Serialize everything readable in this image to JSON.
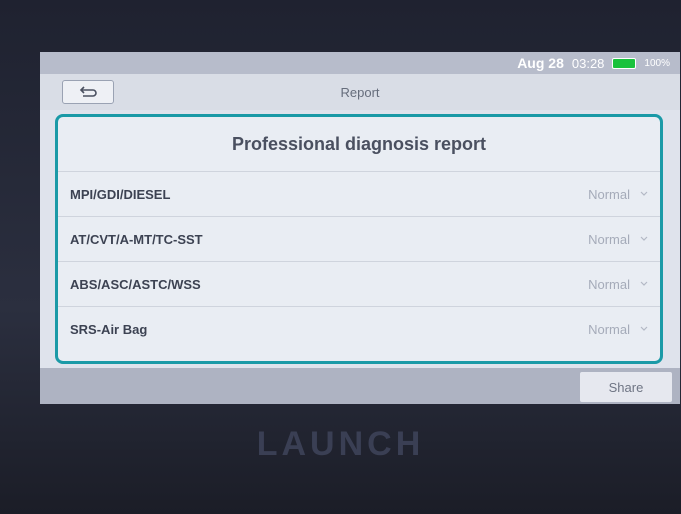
{
  "status": {
    "date": "Aug 28",
    "time": "03:28",
    "battery": "100%"
  },
  "header": {
    "title": "Report"
  },
  "report": {
    "title": "Professional diagnosis report",
    "items": [
      {
        "label": "MPI/GDI/DIESEL",
        "value": "Normal"
      },
      {
        "label": "AT/CVT/A-MT/TC-SST",
        "value": "Normal"
      },
      {
        "label": "ABS/ASC/ASTC/WSS",
        "value": "Normal"
      },
      {
        "label": "SRS-Air Bag",
        "value": "Normal"
      }
    ]
  },
  "footer": {
    "share_label": "Share"
  },
  "device": {
    "brand": "LAUNCH"
  },
  "colors": {
    "accent": "#1b9aa7",
    "battery": "#19c23c"
  },
  "icons": {
    "back": "back-arrow-icon",
    "dropdown": "chevron-down-icon"
  }
}
